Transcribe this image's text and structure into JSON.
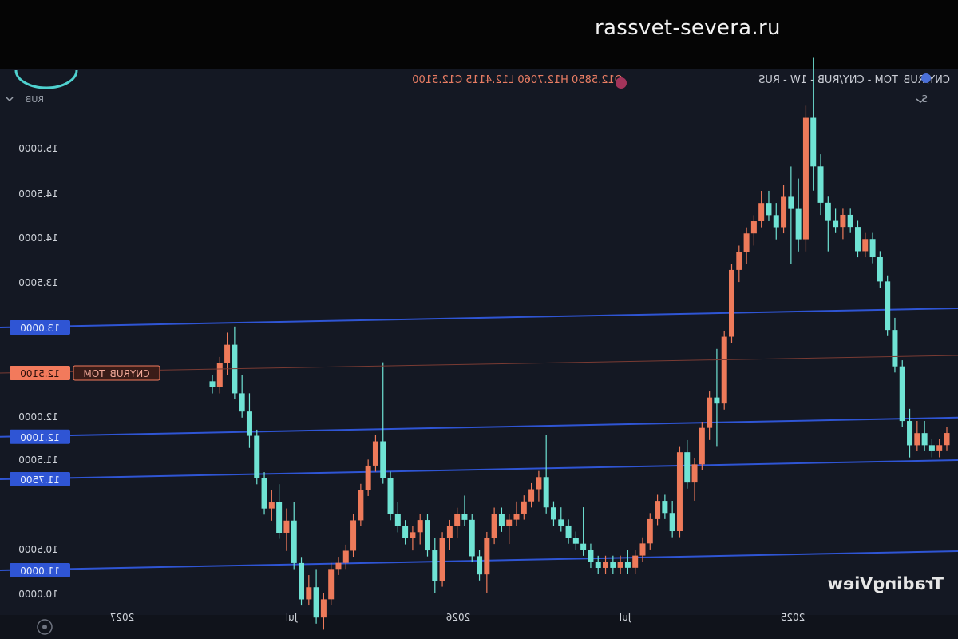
{
  "watermark": "rassvet-severa.ru",
  "header": {
    "symbol_line": "CNY/RUB_TOM - CNY/RUB - 1W - RUS",
    "ohlc": "O12.5850 H12.7060 L12.4115 C12.5100",
    "currency_label": "RUB",
    "right_control": "S"
  },
  "branding": "TradingView",
  "colors": {
    "background": "#141823",
    "up": "#ee7a5a",
    "down": "#6fe3d4",
    "levels": "#2f55d4",
    "price_label": "#f27a5c"
  },
  "chart_data": {
    "type": "candlestick",
    "price_axis_ticks": [
      "15.0000",
      "14.5000",
      "14.0000",
      "13.5000",
      "12.0000",
      "11.5000",
      "10.5000",
      "10.0000"
    ],
    "time_axis_ticks": [
      "2027",
      "Jul",
      "2026",
      "Jul",
      "2025"
    ],
    "horizontal_levels": [
      {
        "label": "13.0000",
        "value": 13.0
      },
      {
        "label": "12.1000",
        "value": 12.1
      },
      {
        "label": "11.7500",
        "value": 11.75
      },
      {
        "label": "11.0000",
        "value": 11.0
      }
    ],
    "current_price": {
      "name": "CNYRUB_TOM",
      "value": "12.5100"
    },
    "candles": [
      [
        12.55,
        12.6,
        12.45,
        12.5
      ],
      [
        12.5,
        12.75,
        12.45,
        12.7
      ],
      [
        12.7,
        12.95,
        12.6,
        12.85
      ],
      [
        12.85,
        13.0,
        12.4,
        12.45
      ],
      [
        12.45,
        12.6,
        12.25,
        12.3
      ],
      [
        12.3,
        12.45,
        12.0,
        12.1
      ],
      [
        12.1,
        12.15,
        11.7,
        11.75
      ],
      [
        11.75,
        11.8,
        11.45,
        11.5
      ],
      [
        11.5,
        11.65,
        11.4,
        11.55
      ],
      [
        11.55,
        11.7,
        11.25,
        11.3
      ],
      [
        11.3,
        11.5,
        11.15,
        11.4
      ],
      [
        11.4,
        11.55,
        11.0,
        11.05
      ],
      [
        11.05,
        11.1,
        10.7,
        10.75
      ],
      [
        10.75,
        10.95,
        10.7,
        10.85
      ],
      [
        10.85,
        11.0,
        10.55,
        10.6
      ],
      [
        10.6,
        10.8,
        10.5,
        10.75
      ],
      [
        10.75,
        11.05,
        10.7,
        11.0
      ],
      [
        11.0,
        11.1,
        10.95,
        11.05
      ],
      [
        11.05,
        11.2,
        11.0,
        11.15
      ],
      [
        11.15,
        11.45,
        11.1,
        11.4
      ],
      [
        11.4,
        11.7,
        11.35,
        11.65
      ],
      [
        11.65,
        11.9,
        11.6,
        11.85
      ],
      [
        11.85,
        12.1,
        11.8,
        12.05
      ],
      [
        12.05,
        12.7,
        11.7,
        11.75
      ],
      [
        11.75,
        11.8,
        11.4,
        11.45
      ],
      [
        11.45,
        11.55,
        11.3,
        11.35
      ],
      [
        11.35,
        11.4,
        11.2,
        11.25
      ],
      [
        11.25,
        11.35,
        11.15,
        11.3
      ],
      [
        11.3,
        11.45,
        11.2,
        11.4
      ],
      [
        11.4,
        11.45,
        11.1,
        11.15
      ],
      [
        11.15,
        11.25,
        10.8,
        10.9
      ],
      [
        10.9,
        11.3,
        10.85,
        11.25
      ],
      [
        11.25,
        11.4,
        11.15,
        11.35
      ],
      [
        11.35,
        11.5,
        11.25,
        11.45
      ],
      [
        11.45,
        11.6,
        11.35,
        11.4
      ],
      [
        11.4,
        11.45,
        11.05,
        11.1
      ],
      [
        11.1,
        11.15,
        10.9,
        10.95
      ],
      [
        10.95,
        11.3,
        10.8,
        11.25
      ],
      [
        11.25,
        11.5,
        11.2,
        11.45
      ],
      [
        11.45,
        11.5,
        11.3,
        11.35
      ],
      [
        11.35,
        11.45,
        11.2,
        11.4
      ],
      [
        11.4,
        11.55,
        11.35,
        11.45
      ],
      [
        11.45,
        11.6,
        11.4,
        11.55
      ],
      [
        11.55,
        11.7,
        11.5,
        11.65
      ],
      [
        11.65,
        11.8,
        11.55,
        11.75
      ],
      [
        11.75,
        12.1,
        11.45,
        11.5
      ],
      [
        11.5,
        11.55,
        11.35,
        11.4
      ],
      [
        11.4,
        11.5,
        11.3,
        11.35
      ],
      [
        11.35,
        11.4,
        11.2,
        11.25
      ],
      [
        11.25,
        11.3,
        11.15,
        11.2
      ],
      [
        11.2,
        11.5,
        11.1,
        11.15
      ],
      [
        11.15,
        11.2,
        11.0,
        11.05
      ],
      [
        11.05,
        11.1,
        10.95,
        11.0
      ],
      [
        11.0,
        11.1,
        10.95,
        11.05
      ],
      [
        11.05,
        11.1,
        10.95,
        11.0
      ],
      [
        11.0,
        11.1,
        10.95,
        11.05
      ],
      [
        11.05,
        11.15,
        10.95,
        11.0
      ],
      [
        11.0,
        11.15,
        10.95,
        11.1
      ],
      [
        11.1,
        11.25,
        11.05,
        11.2
      ],
      [
        11.2,
        11.45,
        11.15,
        11.4
      ],
      [
        11.4,
        11.6,
        11.35,
        11.55
      ],
      [
        11.55,
        11.6,
        11.4,
        11.45
      ],
      [
        11.45,
        11.55,
        11.25,
        11.3
      ],
      [
        11.3,
        12.0,
        11.25,
        11.95
      ],
      [
        11.95,
        12.05,
        11.65,
        11.7
      ],
      [
        11.7,
        11.9,
        11.55,
        11.85
      ],
      [
        11.85,
        12.2,
        11.8,
        12.15
      ],
      [
        12.15,
        12.45,
        12.05,
        12.4
      ],
      [
        12.4,
        12.8,
        12.0,
        12.35
      ],
      [
        12.35,
        12.95,
        12.3,
        12.9
      ],
      [
        12.9,
        13.5,
        12.85,
        13.45
      ],
      [
        13.45,
        13.65,
        13.35,
        13.6
      ],
      [
        13.6,
        13.8,
        13.5,
        13.75
      ],
      [
        13.75,
        13.9,
        13.65,
        13.85
      ],
      [
        13.85,
        14.1,
        13.8,
        14.0
      ],
      [
        14.0,
        14.1,
        13.85,
        13.9
      ],
      [
        13.9,
        14.0,
        13.7,
        13.8
      ],
      [
        13.8,
        14.15,
        13.75,
        14.05
      ],
      [
        14.05,
        14.3,
        13.5,
        13.95
      ],
      [
        13.95,
        14.2,
        13.6,
        13.7
      ],
      [
        13.7,
        14.8,
        13.6,
        14.7
      ],
      [
        14.7,
        15.2,
        14.1,
        14.3
      ],
      [
        14.3,
        14.4,
        13.9,
        14.0
      ],
      [
        14.0,
        14.05,
        13.6,
        13.85
      ],
      [
        13.85,
        13.95,
        13.75,
        13.8
      ],
      [
        13.8,
        13.95,
        13.7,
        13.9
      ],
      [
        13.9,
        13.95,
        13.75,
        13.8
      ],
      [
        13.8,
        13.85,
        13.55,
        13.6
      ],
      [
        13.6,
        13.75,
        13.55,
        13.7
      ],
      [
        13.7,
        13.75,
        13.5,
        13.55
      ],
      [
        13.55,
        13.6,
        13.3,
        13.35
      ],
      [
        13.35,
        13.4,
        12.9,
        12.95
      ],
      [
        12.95,
        13.05,
        12.6,
        12.65
      ],
      [
        12.65,
        12.7,
        12.15,
        12.2
      ],
      [
        12.2,
        12.3,
        11.9,
        12.0
      ],
      [
        12.0,
        12.2,
        11.95,
        12.1
      ],
      [
        12.1,
        12.2,
        11.95,
        12.0
      ],
      [
        12.0,
        12.05,
        11.9,
        11.95
      ],
      [
        11.95,
        12.05,
        11.9,
        12.0
      ],
      [
        12.0,
        12.15,
        11.95,
        12.1
      ]
    ]
  }
}
